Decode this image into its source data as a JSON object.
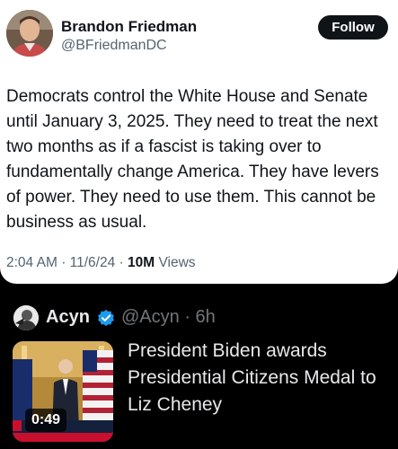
{
  "main_tweet": {
    "author_name": "Brandon Friedman",
    "author_handle": "@BFriedmanDC",
    "follow_label": "Follow",
    "text": "Democrats control the White House and Senate until January 3, 2025. They need to treat the next two months as if a fascist is taking over to fundamentally change America. They have levers of power. They need to use them. This cannot be business as usual.",
    "time": "2:04 AM",
    "date": "11/6/24",
    "views_count": "10M",
    "views_label": "Views"
  },
  "quoted_tweet": {
    "author_name": "Acyn",
    "author_handle": "@Acyn",
    "age": "6h",
    "text": "President Biden awards Presidential Citizens Medal to Liz Cheney",
    "video_duration": "0:49"
  },
  "icons": {
    "verified": "verified-badge-icon",
    "play": "video-thumbnail"
  },
  "colors": {
    "follow_bg": "#0f1419",
    "verified_blue": "#1d9bf0",
    "secondary_text": "#536471"
  }
}
